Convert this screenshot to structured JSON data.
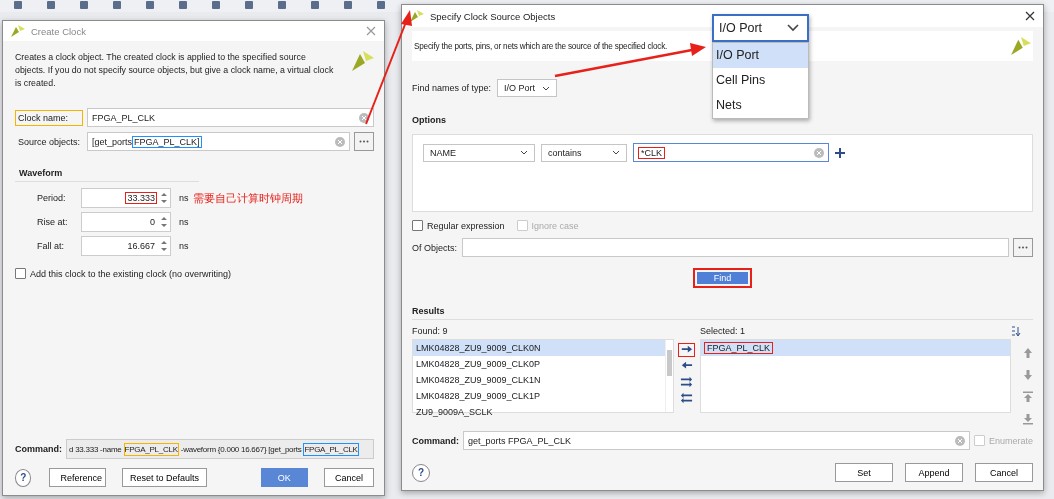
{
  "create_clock": {
    "title": "Create Clock",
    "description": "Creates a clock object. The created clock is applied to the specified source objects. If you do not specify source objects, but give a clock name, a virtual clock is created.",
    "clock_name": {
      "label": "Clock name:",
      "value": "FPGA_PL_CLK",
      "highlighted": true
    },
    "source_objects": {
      "label": "Source objects:",
      "prefix": "[get_ports ",
      "value": "FPGA_PL_CLK]",
      "highlighted": true
    },
    "waveform": {
      "title": "Waveform",
      "fields": [
        {
          "label": "Period:",
          "value": "33.333",
          "unit": "ns",
          "highlighted": true
        },
        {
          "label": "Rise at:",
          "value": "0",
          "unit": "ns",
          "highlighted": false
        },
        {
          "label": "Fall at:",
          "value": "16.667",
          "unit": "ns",
          "highlighted": false
        }
      ]
    },
    "annotation": "需要自己计算时钟周期",
    "add_clock": {
      "label": "Add this clock to the existing clock (no overwriting)",
      "checked": false
    },
    "command": {
      "label": "Command:",
      "parts": [
        {
          "text": "d 33.333 -name "
        },
        {
          "text": "FPGA_PL_CLK",
          "color": "#f5b400"
        },
        {
          "text": " -waveform {0.000 16.667} [get_ports "
        },
        {
          "text": "FPGA_PL_CLK",
          "color": "#1e90ff"
        }
      ]
    },
    "help": "?",
    "buttons": [
      {
        "label": "Reference",
        "primary": false
      },
      {
        "label": "Reset to Defaults",
        "primary": false
      },
      {
        "label": "OK",
        "primary": true
      },
      {
        "label": "Cancel",
        "primary": false
      }
    ]
  },
  "specify_source": {
    "title": "Specify Clock Source Objects",
    "description": "Specify the ports, pins, or nets which are the source of the specified clock.",
    "find_type": {
      "label": "Find names of type:",
      "value": "I/O Port"
    },
    "options": {
      "title": "Options",
      "property": "NAME",
      "operator": "contains",
      "pattern": "*CLK",
      "pattern_highlighted": true
    },
    "regular_expression": {
      "label": "Regular expression",
      "checked": false,
      "disabled": false
    },
    "ignore_case": {
      "label": "Ignore case",
      "checked": false,
      "disabled": true
    },
    "of_objects": {
      "label": "Of Objects:"
    },
    "find_button": {
      "label": "Find",
      "highlighted": true
    },
    "results": {
      "title": "Results",
      "found_label": "Found: 9",
      "found": [
        {
          "name": "LMK04828_ZU9_9009_CLK0N",
          "selected": true
        },
        {
          "name": "LMK04828_ZU9_9009_CLK0P",
          "selected": false
        },
        {
          "name": "LMK04828_ZU9_9009_CLK1N",
          "selected": false
        },
        {
          "name": "LMK04828_ZU9_9009_CLK1P",
          "selected": false
        },
        {
          "name": "ZU9_9009A_SCLK",
          "selected": false
        }
      ],
      "move_buttons": [
        {
          "kind": "add",
          "highlighted": true
        },
        {
          "kind": "remove",
          "highlighted": false
        },
        {
          "kind": "add_all",
          "highlighted": false
        },
        {
          "kind": "remove_all",
          "highlighted": false
        }
      ],
      "selected_label": "Selected: 1",
      "selected_items": [
        {
          "name": "FPGA_PL_CLK",
          "selected": true,
          "highlighted": true
        }
      ]
    },
    "command": {
      "label": "Command:",
      "value": "get_ports FPGA_PL_CLK"
    },
    "enumerate": {
      "label": "Enumerate",
      "checked": false,
      "disabled": true
    },
    "help": "?",
    "buttons": [
      {
        "label": "Set"
      },
      {
        "label": "Append"
      },
      {
        "label": "Cancel"
      }
    ]
  },
  "type_dropdown": {
    "value": "I/O Port",
    "options": [
      {
        "label": "I/O Port",
        "selected": true
      },
      {
        "label": "Cell Pins",
        "selected": false
      },
      {
        "label": "Nets",
        "selected": false
      }
    ]
  }
}
